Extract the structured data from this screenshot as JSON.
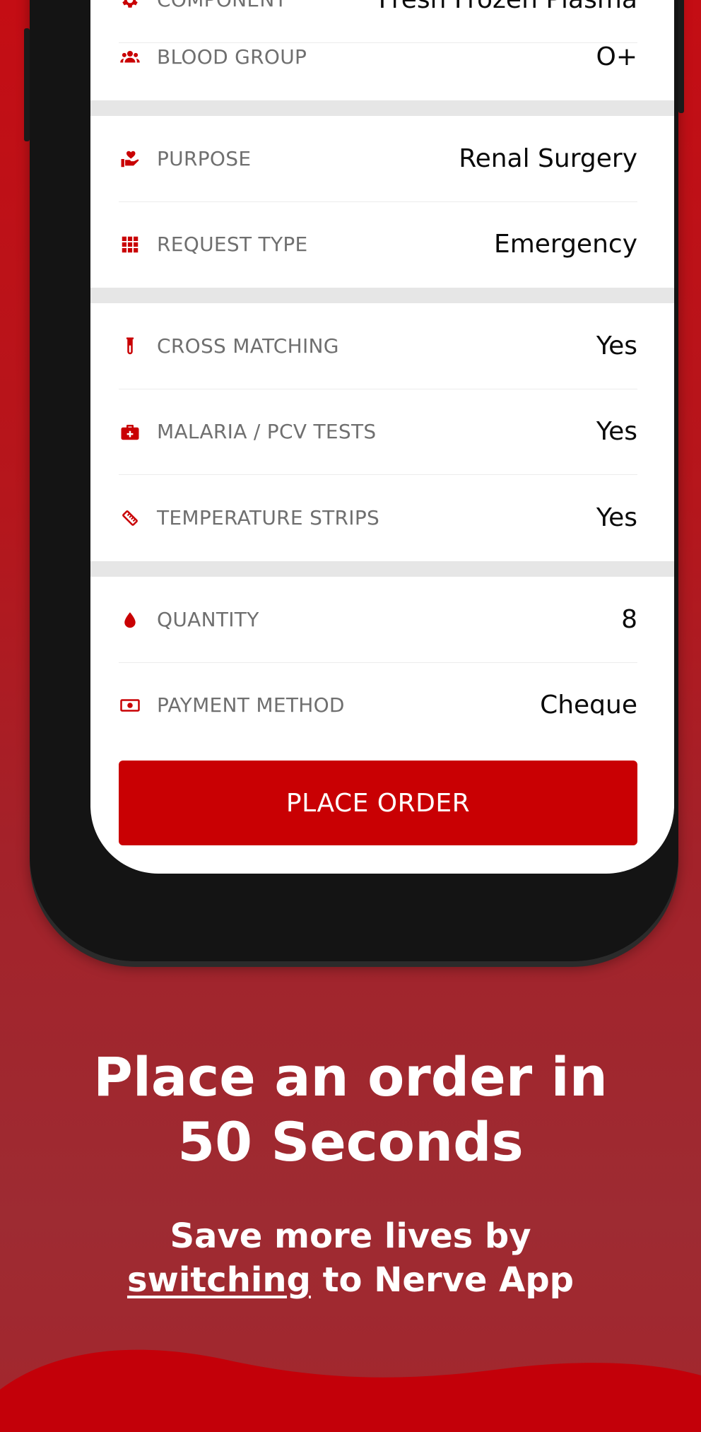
{
  "colors": {
    "accent": "#c90003",
    "icon": "#c90003",
    "label": "#6f6f6f",
    "value": "#0a0a0a"
  },
  "order_form": {
    "rows": [
      {
        "icon": "gear-icon",
        "label": "COMPONENT",
        "value": "Fresh Frozen Plasma"
      },
      {
        "icon": "group-icon",
        "label": "BLOOD GROUP",
        "value": "O+"
      },
      {
        "icon": "hand-heart-icon",
        "label": "PURPOSE",
        "value": "Renal Surgery"
      },
      {
        "icon": "grid-icon",
        "label": "REQUEST TYPE",
        "value": "Emergency"
      },
      {
        "icon": "test-tube-icon",
        "label": "CROSS MATCHING",
        "value": "Yes"
      },
      {
        "icon": "medkit-icon",
        "label": "MALARIA / PCV TESTS",
        "value": "Yes"
      },
      {
        "icon": "strip-icon",
        "label": "TEMPERATURE STRIPS",
        "value": "Yes"
      },
      {
        "icon": "blood-drop-icon",
        "label": "QUANTITY",
        "value": "8"
      },
      {
        "icon": "cash-icon",
        "label": "PAYMENT METHOD",
        "value": "Cheque"
      }
    ],
    "submit_label": "PLACE ORDER"
  },
  "promo": {
    "headline_line1": "Place an order in",
    "headline_line2": "50 Seconds",
    "sub_line1": "Save more lives by",
    "sub_underlined": "switching",
    "sub_rest": " to Nerve App"
  }
}
